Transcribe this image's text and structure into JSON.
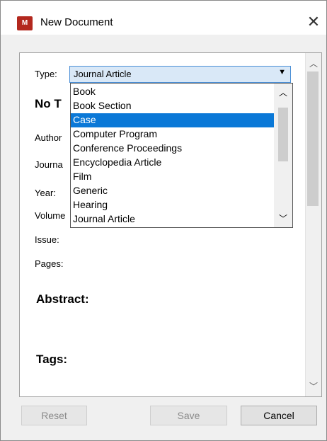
{
  "window": {
    "title": "New Document",
    "logo_text": "M",
    "close_glyph": "✕"
  },
  "form": {
    "type_label": "Type:",
    "type_value": "Journal Article",
    "title_partial": "No T",
    "author_label": "Author",
    "journal_label": "Journa",
    "year_label": "Year:",
    "volume_label": "Volume",
    "issue_label": "Issue:",
    "pages_label": "Pages:",
    "abstract_label": "Abstract:",
    "tags_label": "Tags:"
  },
  "dropdown": {
    "options": [
      "Book",
      "Book Section",
      "Case",
      "Computer Program",
      "Conference Proceedings",
      "Encyclopedia Article",
      "Film",
      "Generic",
      "Hearing",
      "Journal Article"
    ],
    "selected": "Case"
  },
  "buttons": {
    "reset": "Reset",
    "save": "Save",
    "cancel": "Cancel"
  },
  "colors": {
    "logo": "#b3281e",
    "selection": "#0a78d7",
    "select_bg": "#d9e8f7"
  }
}
